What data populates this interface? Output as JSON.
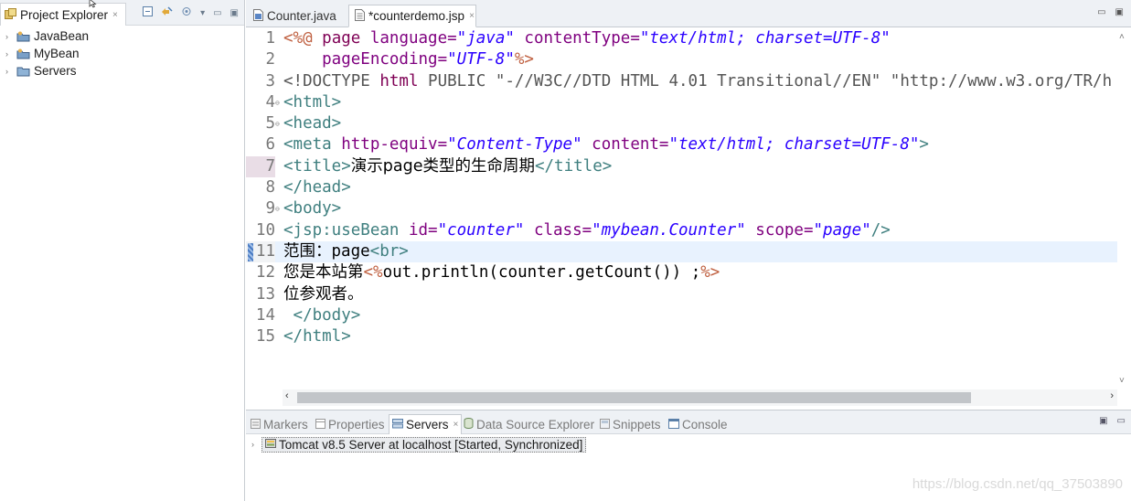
{
  "project_explorer": {
    "title": "Project Explorer",
    "close": "×",
    "items": [
      {
        "label": "JavaBean"
      },
      {
        "label": "MyBean"
      },
      {
        "label": "Servers"
      }
    ]
  },
  "editor": {
    "tabs": [
      {
        "label": "Counter.java",
        "active": false
      },
      {
        "label": "*counterdemo.jsp",
        "close": "×",
        "active": true
      }
    ],
    "line_numbers": [
      "1",
      "2",
      "3",
      "4",
      "5",
      "6",
      "7",
      "8",
      "9",
      "10",
      "11",
      "12",
      "13",
      "14",
      "15"
    ],
    "code_lines": [
      {
        "segs": [
          [
            "<%@ ",
            "dl"
          ],
          [
            "page ",
            "dk"
          ],
          [
            "language=",
            "at"
          ],
          [
            "\"java\"",
            "av"
          ],
          [
            " contentType=",
            "at"
          ],
          [
            "\"text/html; charset=UTF-8\"",
            "av"
          ]
        ]
      },
      {
        "segs": [
          [
            "    pageEncoding=",
            "at"
          ],
          [
            "\"UTF-8\"",
            "av"
          ],
          [
            "%>",
            "dl"
          ]
        ]
      },
      {
        "segs": [
          [
            "<!DOCTYPE ",
            "dt"
          ],
          [
            "html ",
            "dk"
          ],
          [
            "PUBLIC ",
            "dt"
          ],
          [
            "\"-//W3C//DTD HTML 4.01 Transitional//EN\" \"http://www.w3.org/TR/h",
            "dt"
          ]
        ]
      },
      {
        "segs": [
          [
            "<html>",
            "tg"
          ]
        ]
      },
      {
        "segs": [
          [
            "<head>",
            "tg"
          ]
        ]
      },
      {
        "segs": [
          [
            "<meta ",
            "tg"
          ],
          [
            "http-equiv=",
            "at"
          ],
          [
            "\"Content-Type\"",
            "av"
          ],
          [
            " content=",
            "at"
          ],
          [
            "\"text/html; charset=UTF-8\"",
            "av"
          ],
          [
            ">",
            "tg"
          ]
        ]
      },
      {
        "segs": [
          [
            "<title>",
            "tg"
          ],
          [
            "演示page类型的生命周期",
            "tx cn"
          ],
          [
            "</title>",
            "tg"
          ]
        ]
      },
      {
        "segs": [
          [
            "</head>",
            "tg"
          ]
        ]
      },
      {
        "segs": [
          [
            "<body>",
            "tg"
          ]
        ]
      },
      {
        "segs": [
          [
            "<jsp:useBean ",
            "tg"
          ],
          [
            "id=",
            "at"
          ],
          [
            "\"counter\"",
            "av"
          ],
          [
            " class=",
            "at"
          ],
          [
            "\"mybean.Counter\"",
            "av"
          ],
          [
            " scope=",
            "at"
          ],
          [
            "\"page\"",
            "av"
          ],
          [
            "/>",
            "tg"
          ]
        ]
      },
      {
        "segs": [
          [
            "范围：",
            "tx cn"
          ],
          [
            "page",
            "tx"
          ],
          [
            "<br>",
            "tg"
          ]
        ]
      },
      {
        "segs": [
          [
            "您是本站第",
            "tx cn"
          ],
          [
            "<%",
            "dl"
          ],
          [
            "out.println(counter.getCount()) ;",
            "jv"
          ],
          [
            "%>",
            "dl"
          ]
        ]
      },
      {
        "segs": [
          [
            "位参观者。",
            "tx cn"
          ]
        ]
      },
      {
        "segs": [
          [
            " </body>",
            "tg"
          ]
        ]
      },
      {
        "segs": [
          [
            "</html>",
            "tg"
          ]
        ]
      }
    ]
  },
  "bottom_panel": {
    "tabs": [
      {
        "label": "Markers",
        "active": false
      },
      {
        "label": "Properties",
        "active": false
      },
      {
        "label": "Servers",
        "close": "×",
        "active": true
      },
      {
        "label": "Data Source Explorer",
        "active": false
      },
      {
        "label": "Snippets",
        "active": false
      },
      {
        "label": "Console",
        "active": false
      }
    ],
    "server_entry": "Tomcat v8.5 Server at localhost  [Started, Synchronized]"
  },
  "watermark": "https://blog.csdn.net/qq_37503890",
  "icons": {
    "project_explorer": "project-explorer-icon",
    "project": "java-project-icon",
    "java_file": "java-file-icon",
    "jsp_file": "jsp-file-icon",
    "server": "tomcat-server-icon"
  },
  "colors": {
    "tag": "#3f7f7f",
    "attribute": "#7f007f",
    "attribute_value": "#2a00ff",
    "jsp_delimiter": "#bf5f3f",
    "keyword": "#7f0055",
    "current_line": "#e8f2fe"
  }
}
